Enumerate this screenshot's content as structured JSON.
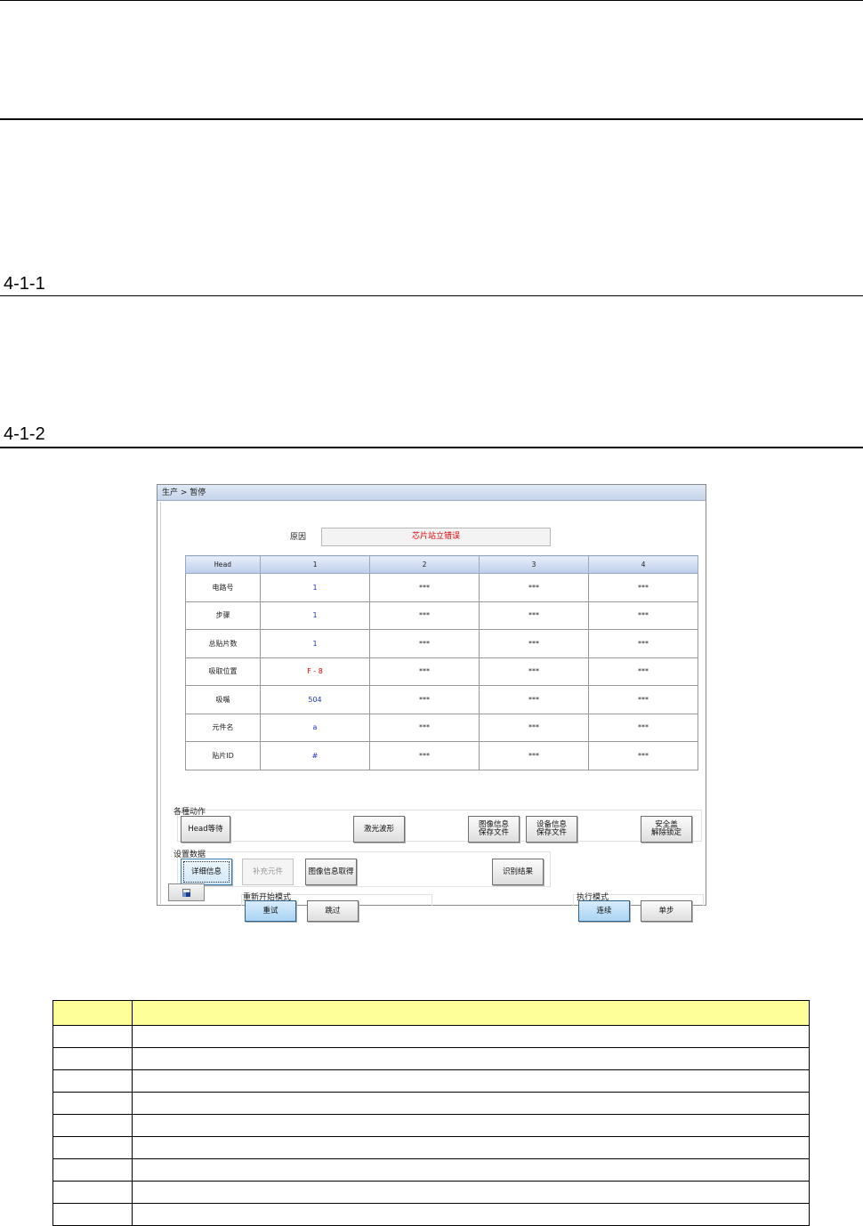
{
  "headings": {
    "h1": "4-1-1",
    "h2": "4-1-2"
  },
  "window": {
    "breadcrumb": "生产 > 暂停",
    "reason_label": "原因",
    "reason_value": "芯片站立错误",
    "table": {
      "columns": [
        "Head",
        "1",
        "2",
        "3",
        "4"
      ],
      "rows": [
        {
          "label": "电路号",
          "values": [
            "1",
            "***",
            "***",
            "***"
          ]
        },
        {
          "label": "步骤",
          "values": [
            "1",
            "***",
            "***",
            "***"
          ]
        },
        {
          "label": "总贴片数",
          "values": [
            "1",
            "***",
            "***",
            "***"
          ]
        },
        {
          "label": "吸取位置",
          "values": [
            "F - 8",
            "***",
            "***",
            "***"
          ]
        },
        {
          "label": "吸嘴",
          "values": [
            "504",
            "***",
            "***",
            "***"
          ]
        },
        {
          "label": "元件名",
          "values": [
            "a",
            "***",
            "***",
            "***"
          ]
        },
        {
          "label": "贴片ID",
          "values": [
            "#",
            "***",
            "***",
            "***"
          ]
        }
      ]
    },
    "groups": {
      "actions_label": "各種动作",
      "settings_label": "设置数据",
      "restart_label": "重新开始模式",
      "exec_label": "执行模式"
    },
    "buttons": {
      "head_wait": "Head等待",
      "laser_wave": "激光波形",
      "image_save": "图像信息\n保存文件",
      "setting_save": "设备信息\n保存文件",
      "safety": "安全盖\n解除锁定",
      "detail": "详细信息",
      "supplement": "补充元件",
      "image_get": "图像信息取得",
      "recog_result": "识别结果",
      "retry": "重试",
      "skip": "跳过",
      "continuous": "连续",
      "single_step": "单步"
    }
  },
  "desc_table": {
    "rows": 10
  }
}
